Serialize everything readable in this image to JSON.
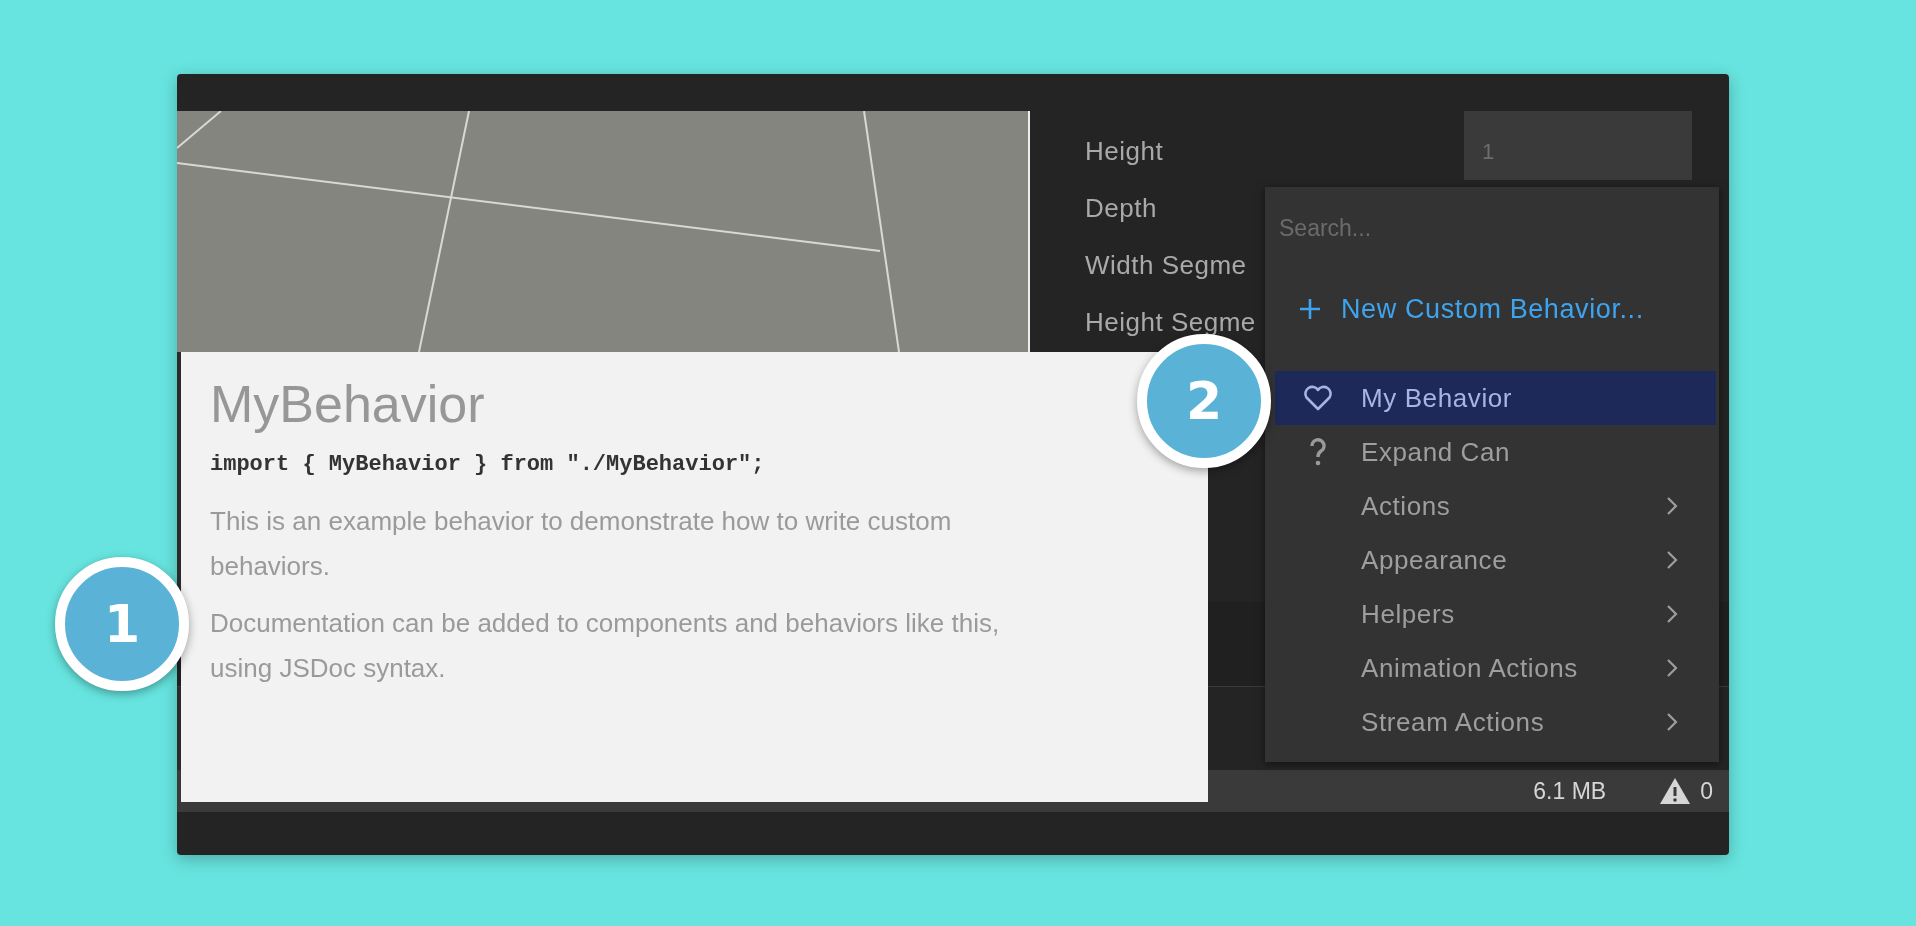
{
  "properties": [
    {
      "label": "Height"
    },
    {
      "label": "Depth"
    },
    {
      "label": "Width Segme"
    },
    {
      "label": "Height Segme"
    }
  ],
  "height_field": {
    "value": "1"
  },
  "doc_popup": {
    "title": "MyBehavior",
    "code": "import { MyBehavior } from \"./MyBehavior\";",
    "paragraphs": [
      "This is an example behavior to demonstrate how to write custom behaviors.",
      "Documentation can be added to components and behaviors like this, using JSDoc syntax."
    ]
  },
  "menu": {
    "search": {
      "placeholder": "Search..."
    },
    "new_item": "New Custom Behavior...",
    "items": [
      {
        "label": "My Behavior",
        "kind": "favorite",
        "selected": true
      },
      {
        "label": "Expand Can",
        "kind": "unknown",
        "selected": false
      },
      {
        "label": "Actions",
        "kind": "category",
        "selected": false
      },
      {
        "label": "Appearance",
        "kind": "category",
        "selected": false
      },
      {
        "label": "Helpers",
        "kind": "category",
        "selected": false
      },
      {
        "label": "Animation Actions",
        "kind": "category",
        "selected": false
      },
      {
        "label": "Stream Actions",
        "kind": "category",
        "selected": false
      }
    ]
  },
  "status_bar": {
    "memory": "6.1 MB",
    "warnings": "0"
  },
  "callouts": [
    {
      "number": "1"
    },
    {
      "number": "2"
    }
  ]
}
